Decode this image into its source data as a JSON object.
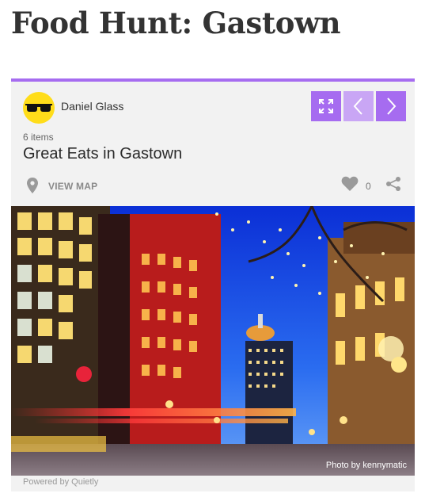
{
  "page": {
    "title": "Food Hunt: Gastown"
  },
  "card": {
    "author": "Daniel Glass",
    "item_count": "6 items",
    "list_title": "Great Eats in Gastown",
    "view_map_label": "VIEW MAP",
    "likes": "0",
    "photo_credit": "Photo by kennymatic",
    "powered_by": "Powered by Quietly"
  },
  "icons": {
    "expand": "expand-icon",
    "prev": "chevron-left-icon",
    "next": "chevron-right-icon",
    "map": "map-pin-icon",
    "like": "heart-icon",
    "share": "share-icon"
  },
  "colors": {
    "accent": "#a66cf0",
    "accent_light": "#c9a6f5",
    "avatar": "#ffdd1a",
    "card_bg": "#f2f2f2"
  }
}
